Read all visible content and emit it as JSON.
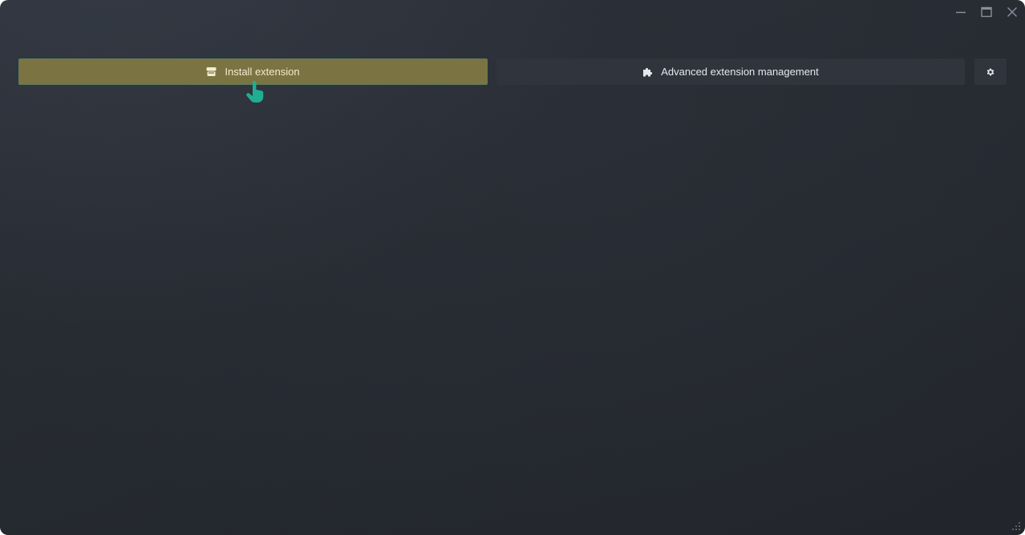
{
  "window": {
    "controls": {
      "minimize_icon": "minimize-icon",
      "maximize_icon": "maximize-icon",
      "close_icon": "close-icon"
    }
  },
  "toolbar": {
    "install_label": "Install extension",
    "install_icon": "store-icon",
    "advanced_label": "Advanced extension management",
    "advanced_icon": "puzzle-icon",
    "settings_icon": "gear-icon"
  },
  "colors": {
    "background": "#262a31",
    "install_button_bg": "#7b7342",
    "install_button_text": "#f2ecd0",
    "secondary_button_bg": "#30343d",
    "cursor": "#1fae93"
  }
}
